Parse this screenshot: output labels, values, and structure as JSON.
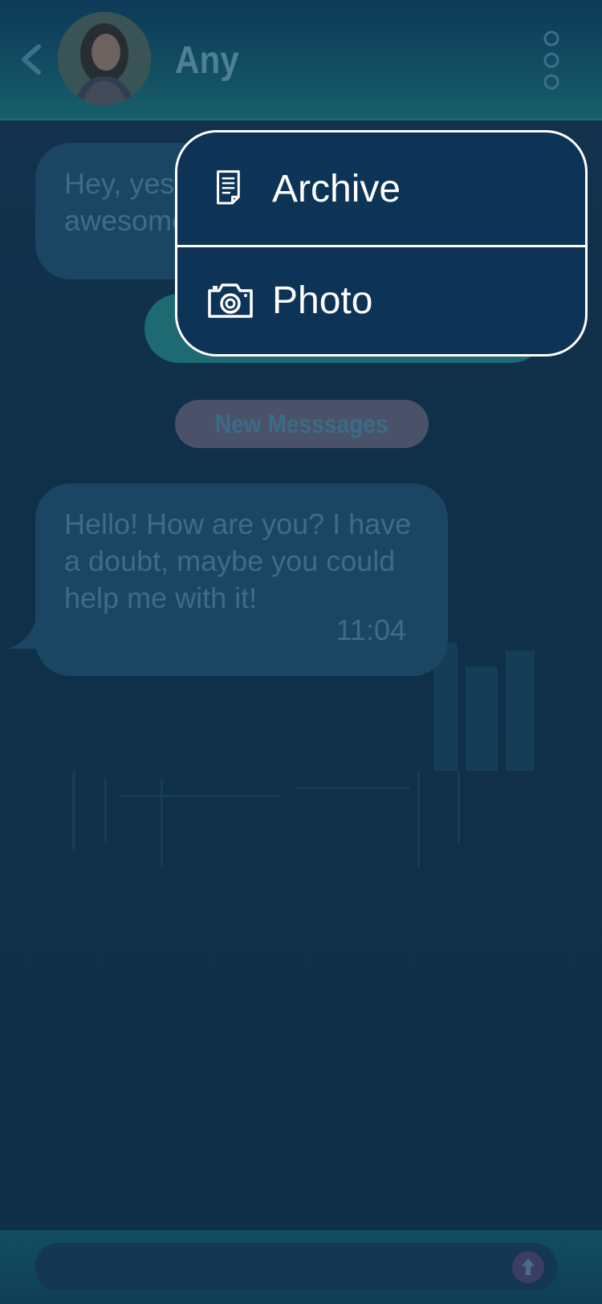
{
  "header": {
    "contact_name": "Any",
    "icons": [
      "chevron-left-icon",
      "avatar",
      "more-vertical-icon"
    ]
  },
  "messages": [
    {
      "direction": "incoming",
      "text": "Hey, yes! It was awesome!"
    },
    {
      "direction": "outgoing",
      "text": ""
    },
    {
      "direction": "incoming",
      "text": "Hello! How are you? I have a doubt, maybe you could help me with it!",
      "time": "11:04"
    }
  ],
  "divider": {
    "label": "New Messsages"
  },
  "menu": {
    "items": [
      {
        "label": "Archive",
        "icon": "document-icon"
      },
      {
        "label": "Photo",
        "icon": "camera-icon"
      }
    ]
  },
  "composer": {
    "placeholder": "",
    "send_icon": "arrow-up-icon"
  },
  "colors": {
    "background": "#102f49",
    "header": "#135264",
    "menu_background": "#0d3356",
    "menu_border": "#ffffff",
    "incoming_bubble": "#1a4563",
    "outgoing_bubble": "#1e6a72",
    "new_messages_pill": "#4a526a"
  }
}
